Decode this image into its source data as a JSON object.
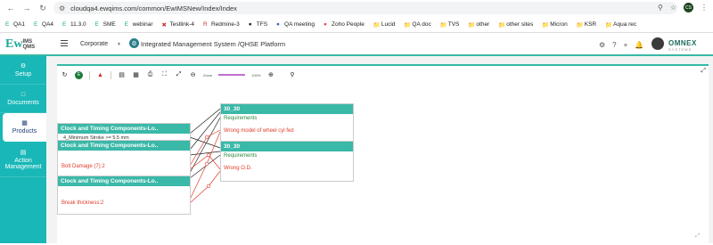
{
  "browser": {
    "url": "cloudqa4.ewqims.com/common/EwIMSNew/Index/Index",
    "bookmarks": [
      "QA1",
      "QA4",
      "11.3.0",
      "SME",
      "webinar",
      "Testlink-4",
      "Redmine-3",
      "TFS",
      "QA meeting",
      "Zoho People",
      "Lucid",
      "QA doc",
      "TVS",
      "other",
      "other sites",
      "Micron",
      "KSR",
      "Aqua rec"
    ],
    "profile_initials": "CS"
  },
  "app": {
    "logo_text": "Ew",
    "logo_sub": "IMS",
    "logo_sub2": "QMS",
    "company": "Corporate",
    "platform_title": "Integrated Management System /QHSE Platform",
    "brand": "OMNEX",
    "brand_sub": "SYSTEMS"
  },
  "sidebar": {
    "items": [
      {
        "label": "Setup",
        "icon": "settings-icon"
      },
      {
        "label": "Documents",
        "icon": "document-icon"
      },
      {
        "label": "Products",
        "icon": "product-icon",
        "active": true
      },
      {
        "label": "Action Management",
        "icon": "action-icon"
      }
    ]
  },
  "toolbar": {
    "zoom_label": "Zoom",
    "zoom_value": "100%"
  },
  "diagram": {
    "left_boxes": [
      {
        "title": "Clock and Timing Components-Lo..",
        "line1": "4_Minimum Stroke  >= 5.5 mm"
      },
      {
        "title": "Clock and Timing Components-Lo..",
        "red": "Bolt Damage (7):2"
      },
      {
        "title": "Clock and Timing Components-Lo..",
        "red": "Break thickness:2"
      }
    ],
    "right_boxes": [
      {
        "title": "30_30",
        "green": "Requirements",
        "red": "Wrong model of wheel cyl fed"
      },
      {
        "title": "30_30",
        "green": "Requirements",
        "red": "Wrong O.D."
      }
    ]
  }
}
